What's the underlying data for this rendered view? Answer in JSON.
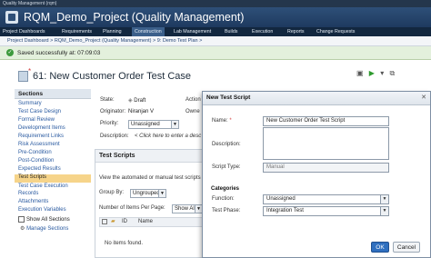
{
  "window": {
    "title": "Quality Management (rqm)"
  },
  "header": {
    "project_title": "RQM_Demo_Project (Quality Management)"
  },
  "nav": {
    "items": [
      "Project Dashboards",
      "Requirements",
      "Planning",
      "Construction",
      "Lab Management",
      "Builds",
      "Execution",
      "Reports",
      "Change Requests"
    ]
  },
  "breadcrumb": "Project Dashboard > RQM_Demo_Project (Quality Management) > 9: Demo Test Plan >",
  "status": {
    "message": "Saved successfully at: 07:09:03"
  },
  "page": {
    "title": "61: New Customer Order Test Case"
  },
  "sidebar": {
    "header": "Sections",
    "items": [
      "Summary",
      "Test Case Design",
      "Formal Review",
      "Development Items",
      "Requirement Links",
      "Risk Assessment",
      "Pre-Condition",
      "Post-Condition",
      "Expected Results",
      "Test Scripts",
      "Test Case Execution",
      "Records",
      "Attachments",
      "Execution Variables"
    ],
    "show_all": "Show All Sections",
    "manage": "Manage Sections"
  },
  "details": {
    "state_label": "State:",
    "state_value": "Draft",
    "originator_label": "Originator:",
    "originator_value": "Niranjan V",
    "priority_label": "Priority:",
    "priority_value": "Unassigned",
    "description_label": "Description:",
    "description_placeholder": "< Click here to enter a desc",
    "action_label": "Action",
    "owner_label": "Owne"
  },
  "test_scripts": {
    "header": "Test Scripts",
    "desc": "View the automated or manual test scripts",
    "group_by_label": "Group By:",
    "group_by_value": "Ungrouped",
    "items_per_page_label": "Number of Items Per Page:",
    "items_per_page_value": "Show All",
    "col_id": "ID",
    "col_name": "Name",
    "empty": "No items found."
  },
  "dialog": {
    "title": "New Test Script",
    "name_label": "Name:",
    "name_value": "New Customer Order Test Script",
    "description_label": "Description:",
    "script_type_label": "Script Type:",
    "script_type_value": "Manual",
    "categories_header": "Categories",
    "function_label": "Function:",
    "function_value": "Unassigned",
    "test_phase_label": "Test Phase:",
    "test_phase_value": "Integration Test",
    "ok": "OK",
    "cancel": "Cancel"
  }
}
